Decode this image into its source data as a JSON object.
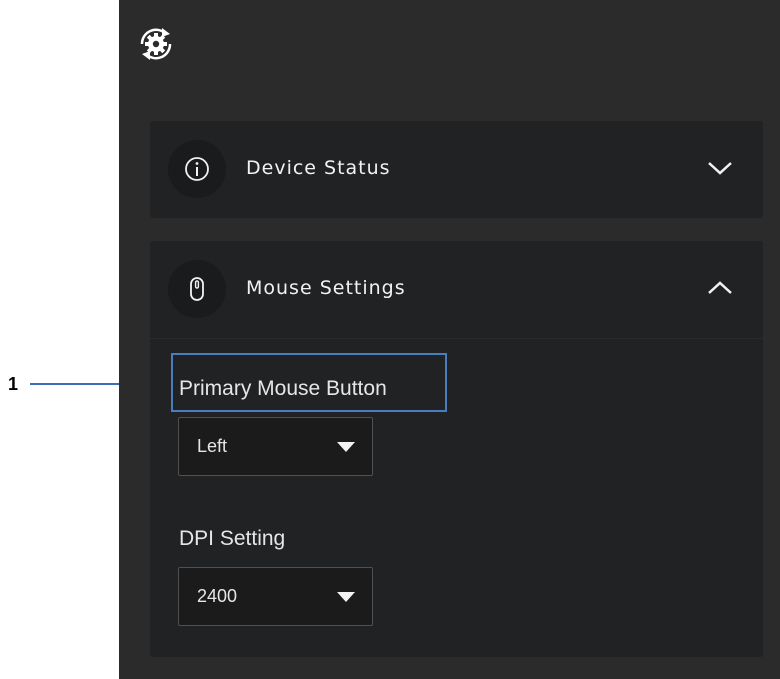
{
  "callout": {
    "number": "1"
  },
  "header": {
    "icon": "settings-sync-icon"
  },
  "panels": {
    "device_status": {
      "title": "Device Status",
      "icon": "info-icon",
      "state_icon": "chevron-down-icon"
    },
    "mouse_settings": {
      "title": "Mouse Settings",
      "icon": "mouse-icon",
      "state_icon": "chevron-up-icon",
      "primary_button": {
        "label": "Primary Mouse Button",
        "value": "Left"
      },
      "dpi": {
        "label": "DPI Setting",
        "value": "2400"
      }
    }
  },
  "colors": {
    "app_bg": "#2b2b2b",
    "panel_bg": "#212223",
    "callout_blue": "#4a7cc0",
    "text": "#f2f2f2"
  }
}
